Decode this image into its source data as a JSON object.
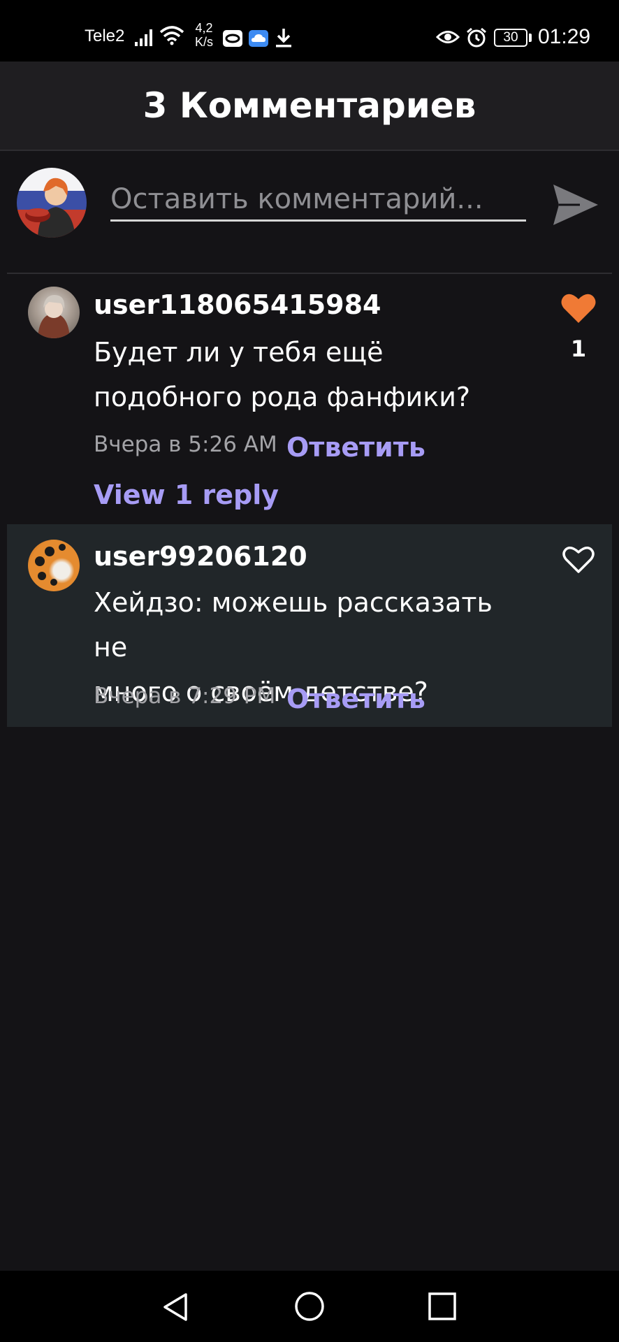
{
  "status_bar": {
    "carrier": "Tele2",
    "speed_line1": "4,2",
    "speed_line2": "K/s",
    "battery": "30",
    "time": "01:29",
    "icons": [
      "signal-icon",
      "wifi-icon",
      "app-icon",
      "cloud-icon",
      "download-icon",
      "eye-icon",
      "alarm-icon",
      "battery-icon"
    ]
  },
  "header": {
    "title": "3 Комментариев"
  },
  "compose": {
    "placeholder": "Оставить комментарий...",
    "send_icon": "send-icon"
  },
  "comments": [
    {
      "username": "user118065415984",
      "text_line1": "Будет ли у тебя ещё",
      "text_line2": "подобного рода фанфики?",
      "time": "Вчера в 5:26 AM",
      "reply_label": "Ответить",
      "view_replies": "View 1 reply",
      "liked": true,
      "like_count": "1"
    },
    {
      "username": "user99206120",
      "text_line1": "Хейдзо: можешь рассказать не",
      "text_line2": "много о своём детстве?",
      "time": "Вчера в 7:29 PM",
      "reply_label": "Ответить",
      "liked": false
    }
  ],
  "colors": {
    "background": "#141316",
    "accent": "#a79cf5",
    "like_active": "#f07a35",
    "highlight_row": "#212629"
  }
}
